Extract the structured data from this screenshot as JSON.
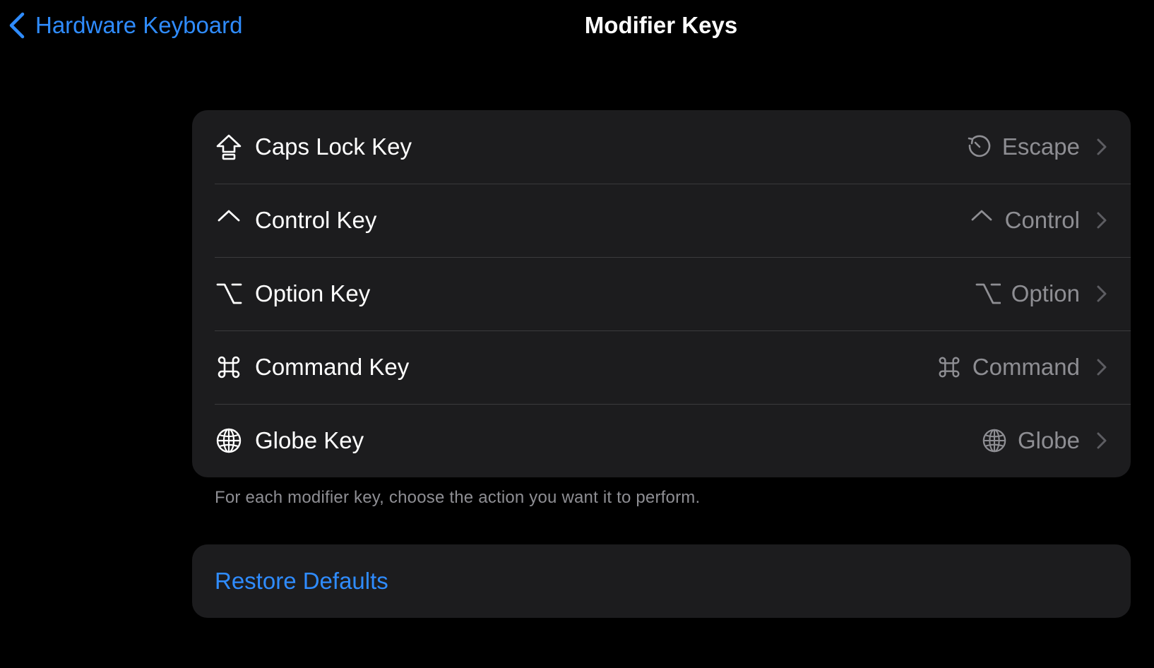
{
  "navbar": {
    "back_label": "Hardware Keyboard",
    "title": "Modifier Keys"
  },
  "modifier_keys": [
    {
      "label": "Caps Lock Key",
      "icon": "capslock-icon",
      "value": "Escape",
      "value_icon": "escape-icon"
    },
    {
      "label": "Control Key",
      "icon": "control-icon",
      "value": "Control",
      "value_icon": "control-icon"
    },
    {
      "label": "Option Key",
      "icon": "option-icon",
      "value": "Option",
      "value_icon": "option-icon"
    },
    {
      "label": "Command Key",
      "icon": "command-icon",
      "value": "Command",
      "value_icon": "command-icon"
    },
    {
      "label": "Globe Key",
      "icon": "globe-icon",
      "value": "Globe",
      "value_icon": "globe-icon"
    }
  ],
  "footer_note": "For each modifier key, choose the action you want it to perform.",
  "restore": {
    "label": "Restore Defaults"
  },
  "colors": {
    "background": "#000000",
    "group_background": "#1c1c1e",
    "accent": "#2f8cff",
    "secondary_text": "#8e8e93",
    "separator": "#3a3a3c"
  }
}
